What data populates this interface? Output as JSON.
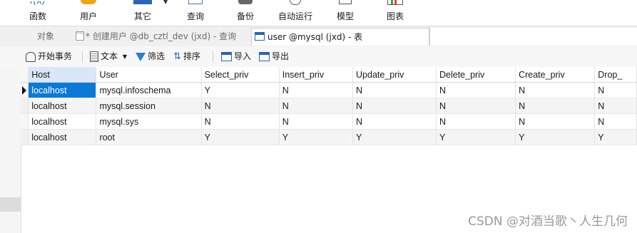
{
  "ribbon": {
    "items": [
      {
        "label": "函数"
      },
      {
        "label": "用户"
      },
      {
        "label": "其它"
      },
      {
        "label": "查询"
      },
      {
        "label": "备份"
      },
      {
        "label": "自动运行"
      },
      {
        "label": "模型"
      },
      {
        "label": "图表"
      }
    ]
  },
  "tabs": [
    {
      "label": "对象"
    },
    {
      "label": "* 创建用户 @db_cztl_dev (jxd) - 查询"
    },
    {
      "label": "user @mysql (jxd) - 表"
    }
  ],
  "toolbar": {
    "begin_transaction": "开始事务",
    "text": "文本",
    "filter": "筛选",
    "sort": "排序",
    "import": "导入",
    "export": "导出"
  },
  "table": {
    "columns": [
      "Host",
      "User",
      "Select_priv",
      "Insert_priv",
      "Update_priv",
      "Delete_priv",
      "Create_priv",
      "Drop_"
    ],
    "rows": [
      [
        "localhost",
        "mysql.infoschema",
        "Y",
        "N",
        "N",
        "N",
        "N",
        "N"
      ],
      [
        "localhost",
        "mysql.session",
        "N",
        "N",
        "N",
        "N",
        "N",
        "N"
      ],
      [
        "localhost",
        "mysql.sys",
        "N",
        "N",
        "N",
        "N",
        "N",
        "N"
      ],
      [
        "localhost",
        "root",
        "Y",
        "Y",
        "Y",
        "Y",
        "Y",
        "Y"
      ]
    ]
  },
  "watermark": "CSDN @对酒当歌丶人生几何",
  "colors": {
    "selection": "#0a7ad6",
    "header_selected": "#d8e8f8"
  }
}
